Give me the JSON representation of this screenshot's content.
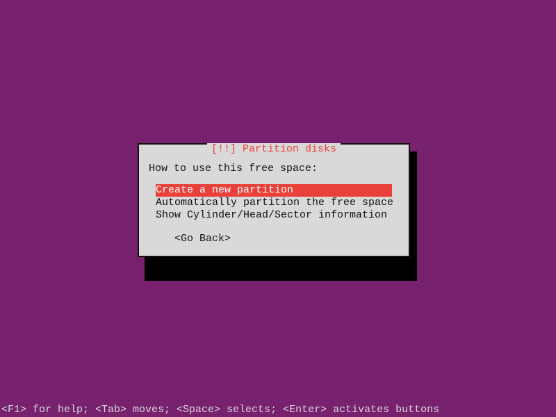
{
  "dialog": {
    "title_left": "[!!] ",
    "title_text": "Partition disks",
    "prompt": "How to use this free space:",
    "options": [
      {
        "label": "Create a new partition",
        "selected": true
      },
      {
        "label": "Automatically partition the free space",
        "selected": false
      },
      {
        "label": "Show Cylinder/Head/Sector information",
        "selected": false
      }
    ],
    "go_back": "<Go Back>"
  },
  "help_bar": "<F1> for help; <Tab> moves; <Space> selects; <Enter> activates buttons"
}
